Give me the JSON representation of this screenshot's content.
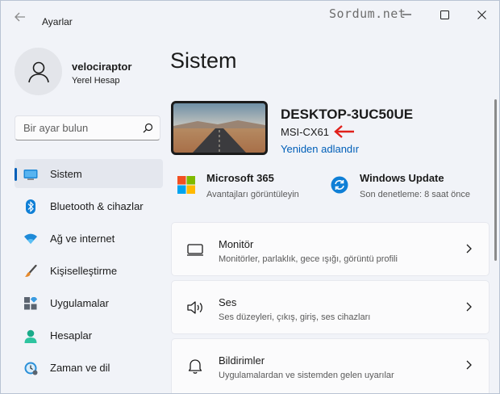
{
  "window": {
    "app_title": "Ayarlar",
    "watermark": "Sordum.net"
  },
  "profile": {
    "name": "velociraptor",
    "account_type": "Yerel Hesap"
  },
  "search": {
    "placeholder": "Bir ayar bulun"
  },
  "sidebar": {
    "items": [
      {
        "label": "Sistem",
        "icon": "monitor-icon",
        "active": true
      },
      {
        "label": "Bluetooth & cihazlar",
        "icon": "bluetooth-icon"
      },
      {
        "label": "Ağ ve internet",
        "icon": "wifi-icon"
      },
      {
        "label": "Kişiselleştirme",
        "icon": "brush-icon"
      },
      {
        "label": "Uygulamalar",
        "icon": "apps-icon"
      },
      {
        "label": "Hesaplar",
        "icon": "person-icon"
      },
      {
        "label": "Zaman ve dil",
        "icon": "clock-globe-icon"
      }
    ]
  },
  "main": {
    "title": "Sistem",
    "device": {
      "name": "DESKTOP-3UC50UE",
      "model": "MSI-CX61",
      "rename_link": "Yeniden adlandır"
    },
    "quick": [
      {
        "title": "Microsoft 365",
        "subtitle": "Avantajları görüntüleyin",
        "icon": "microsoft-logo-icon"
      },
      {
        "title": "Windows Update",
        "subtitle": "Son denetleme: 8 saat önce",
        "icon": "sync-icon"
      }
    ],
    "cards": [
      {
        "title": "Monitör",
        "subtitle": "Monitörler, parlaklık, gece ışığı, görüntü profili",
        "icon": "display-icon"
      },
      {
        "title": "Ses",
        "subtitle": "Ses düzeyleri, çıkış, giriş, ses cihazları",
        "icon": "speaker-icon"
      },
      {
        "title": "Bildirimler",
        "subtitle": "Uygulamalardan ve sistemden gelen uyarılar",
        "icon": "bell-icon"
      }
    ]
  },
  "colors": {
    "accent": "#005fb8",
    "annotation_arrow": "#e0201b"
  }
}
